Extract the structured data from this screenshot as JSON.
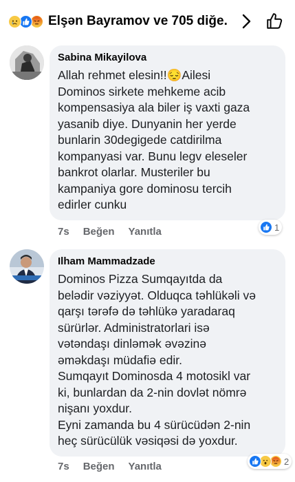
{
  "header": {
    "title": "Elşən Bayramov ve 705 diğe...",
    "reactions": [
      "sad-reaction-icon",
      "like-reaction-icon",
      "angry-reaction-icon"
    ]
  },
  "comments": [
    {
      "author": "Sabina Mikayilova",
      "text": "Allah rehmet elesin!!😔Ailesi\nDominos sirkete mehkeme acib\nkompensasiya ala biler iş vaxti gaza\nyasanib diye. Dunyanin her yerde\nbunlarin 30degigede catdirilma\nkompanyasi var. Bunu legv eleseler\nbankrot olarlar. Musteriler bu\nkampaniya gore  dominosu tercih\nedirler cunku",
      "time": "7s",
      "like_label": "Beğen",
      "reply_label": "Yanıtla",
      "reaction_count": "1"
    },
    {
      "author": "Ilham Mammadzade",
      "text": "Dominos Pizza Sumqayıtda da\nbelədir vəziyyət. Olduqca təhlükəli və\nqarşı tərəfə də təhlükə yaradaraq\nsürürlər. Administratorlari isə\nvətəndaşı dinləmək əvəzinə\nəməkdaşı müdafiə edir.\nSumqayıt Dominosda 4 motosikl var\nki, bunlardan da 2-nin dovlət nömrə\nnişanı yoxdur.\nEyni zamanda bu 4 sürücüdən 2-nin\nheç sürücülük vəsiqəsi də yoxdur.",
      "time": "7s",
      "like_label": "Beğen",
      "reply_label": "Yanıtla",
      "reaction_count": "2"
    }
  ],
  "colors": {
    "bubble": "#f0f2f5",
    "like_blue": "#1877f2",
    "meta_gray": "#65676b"
  }
}
